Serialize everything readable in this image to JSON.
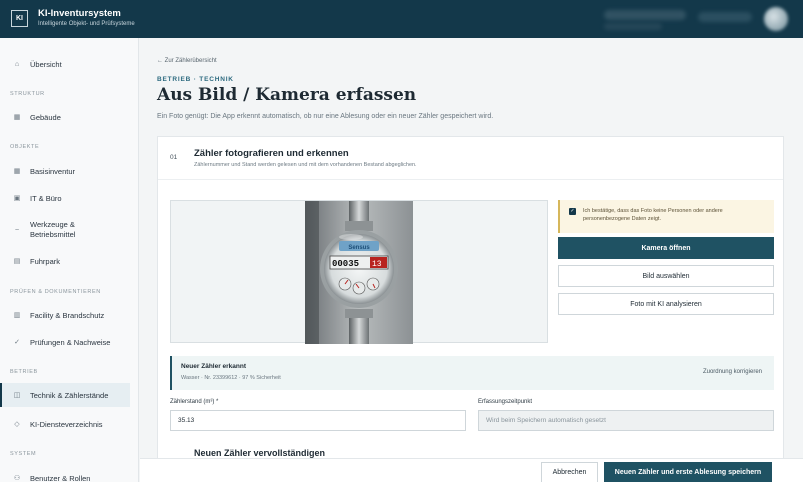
{
  "header": {
    "logo": "KI",
    "title": "KI-Inventursystem",
    "subtitle": "Intelligente Objekt- und Prüfsysteme"
  },
  "sidebar": {
    "overview": {
      "label": "Übersicht",
      "icon": "home-icon"
    },
    "sections": {
      "struktur": "STRUKTUR",
      "objekte": "OBJEKTE",
      "pruefen": "PRÜFEN & DOKUMENTIEREN",
      "betrieb": "BETRIEB",
      "system": "SYSTEM"
    },
    "items": {
      "gebaeude": "Gebäude",
      "basisinventur": "Basisinventur",
      "it_buero": "IT & Büro",
      "werkzeuge_1": "Werkzeuge &",
      "werkzeuge_2": "Betriebsmittel",
      "fuhrpark": "Fuhrpark",
      "facility": "Facility & Brandschutz",
      "pruefungen": "Prüfungen & Nachweise",
      "technik": "Technik & Zählerstände",
      "ki_dienste": "KI-Diensteverzeichnis",
      "benutzer": "Benutzer & Rollen"
    },
    "active": "technik"
  },
  "main": {
    "back_link": "← Zur Zählerübersicht",
    "eyebrow": "BETRIEB · TECHNIK",
    "title": "Aus Bild / Kamera erfassen",
    "description": "Ein Foto genügt: Die App erkennt automatisch, ob nur eine Ablesung oder ein neuer Zähler gespeichert wird."
  },
  "step": {
    "number": "01",
    "title": "Zähler fotografieren und erkennen",
    "subtitle": "Zählernummer und Stand werden gelesen und mit dem vorhandenen Bestand abgeglichen."
  },
  "photo": {
    "meter_reading": "00035",
    "meter_fraction": "13",
    "brand": "Sensus"
  },
  "consent": {
    "checked": true,
    "text": "Ich bestätige, dass das Foto keine Personen oder andere personenbezogene Daten zeigt."
  },
  "actions": {
    "camera": "Kamera öffnen",
    "select_image": "Bild auswählen",
    "analyze": "Foto mit KI analysieren"
  },
  "detection": {
    "title": "Neuer Zähler erkannt",
    "details": "Wasser · Nr. 23399612 · 97 % Sicherheit",
    "correct_link": "Zuordnung korrigieren"
  },
  "form": {
    "reading_label": "Zählerstand (m³) *",
    "reading_value": "35.13",
    "timestamp_label": "Erfassungszeitpunkt",
    "timestamp_placeholder": "Wird beim Speichern automatisch gesetzt"
  },
  "next_step_title": "Neuen Zähler vervollständigen",
  "footer": {
    "cancel": "Abbrechen",
    "save": "Neuen Zähler und erste Ablesung speichern"
  },
  "colors": {
    "header_bg": "#13384a",
    "primary": "#1f5263",
    "accent_text": "#2e6b80",
    "consent_bg": "#fbf5e3"
  }
}
